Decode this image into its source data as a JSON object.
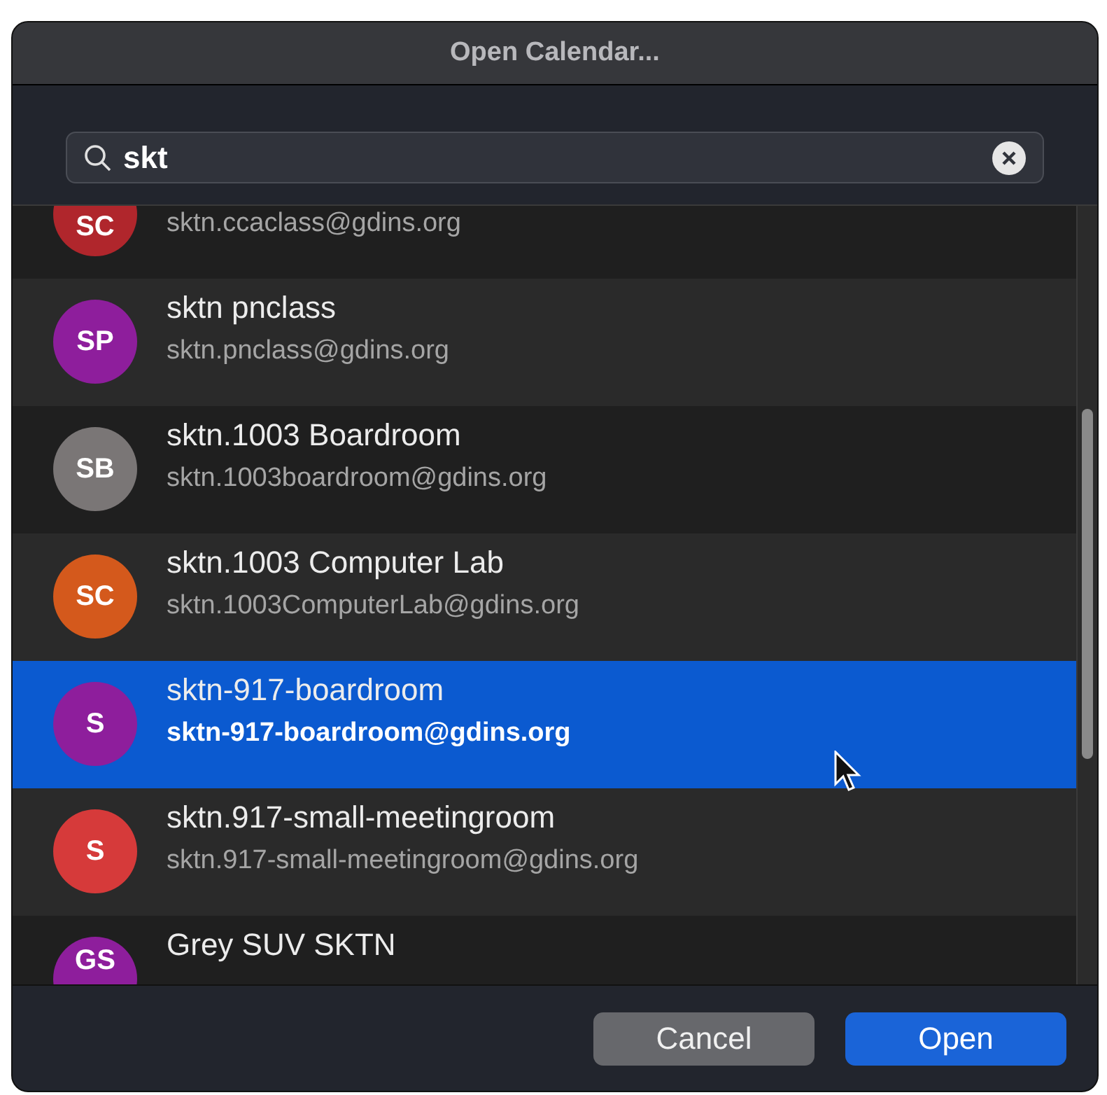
{
  "window": {
    "title": "Open Calendar..."
  },
  "search": {
    "value": "skt"
  },
  "calendars": [
    {
      "initials": "SC",
      "email": "sktn.ccaclass@gdins.org",
      "color": "#b0262c",
      "selected": false
    },
    {
      "initials": "SP",
      "name": "sktn pnclass",
      "email": "sktn.pnclass@gdins.org",
      "color": "#8e1e9c",
      "selected": false
    },
    {
      "initials": "SB",
      "name": "sktn.1003 Boardroom",
      "email": "sktn.1003boardroom@gdins.org",
      "color": "#7a7676",
      "selected": false
    },
    {
      "initials": "SC",
      "name": "sktn.1003 Computer Lab",
      "email": "sktn.1003ComputerLab@gdins.org",
      "color": "#d4591c",
      "selected": false
    },
    {
      "initials": "S",
      "name": "sktn-917-boardroom",
      "email": "sktn-917-boardroom@gdins.org",
      "color": "#8e1e9c",
      "selected": true
    },
    {
      "initials": "S",
      "name": "sktn.917-small-meetingroom",
      "email": "sktn.917-small-meetingroom@gdins.org",
      "color": "#d63a3a",
      "selected": false
    },
    {
      "initials": "GS",
      "name": "Grey SUV SKTN",
      "color": "#8e1e9c",
      "selected": false
    }
  ],
  "buttons": [
    {
      "label": "Cancel",
      "kind": "secondary"
    },
    {
      "label": "Open",
      "kind": "primary"
    }
  ]
}
